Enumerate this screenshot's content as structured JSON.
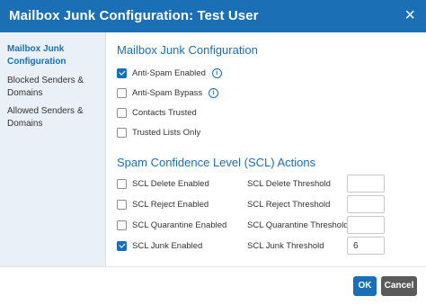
{
  "dialog": {
    "title": "Mailbox Junk Configuration: Test User",
    "close_glyph": "×"
  },
  "sidebar": {
    "items": [
      {
        "label": "Mailbox Junk Configuration",
        "active": true
      },
      {
        "label": "Blocked Senders & Domains",
        "active": false
      },
      {
        "label": "Allowed Senders & Domains",
        "active": false
      }
    ]
  },
  "main": {
    "section1_title": "Mailbox Junk Configuration",
    "options": [
      {
        "label": "Anti-Spam Enabled",
        "checked": true,
        "info": true
      },
      {
        "label": "Anti-Spam Bypass",
        "checked": false,
        "info": true
      },
      {
        "label": "Contacts Trusted",
        "checked": false,
        "info": false
      },
      {
        "label": "Trusted Lists Only",
        "checked": false,
        "info": false
      }
    ],
    "section2_title": "Spam Confidence Level (SCL) Actions",
    "scl": [
      {
        "label": "SCL Delete Enabled",
        "checked": false,
        "threshold_label": "SCL Delete Threshold",
        "threshold_value": ""
      },
      {
        "label": "SCL Reject Enabled",
        "checked": false,
        "threshold_label": "SCL Reject Threshold",
        "threshold_value": ""
      },
      {
        "label": "SCL Quarantine Enabled",
        "checked": false,
        "threshold_label": "SCL Quarantine Threshold",
        "threshold_value": ""
      },
      {
        "label": "SCL Junk Enabled",
        "checked": true,
        "threshold_label": "SCL Junk Threshold",
        "threshold_value": "6"
      }
    ]
  },
  "footer": {
    "ok_label": "OK",
    "cancel_label": "Cancel"
  },
  "colors": {
    "accent": "#1a6fb5",
    "sidebar_bg": "#eaf0f7",
    "cancel_bg": "#5a5a5a"
  },
  "icons": {
    "info": "info-icon",
    "close": "close-icon",
    "check": "checkmark-icon"
  }
}
